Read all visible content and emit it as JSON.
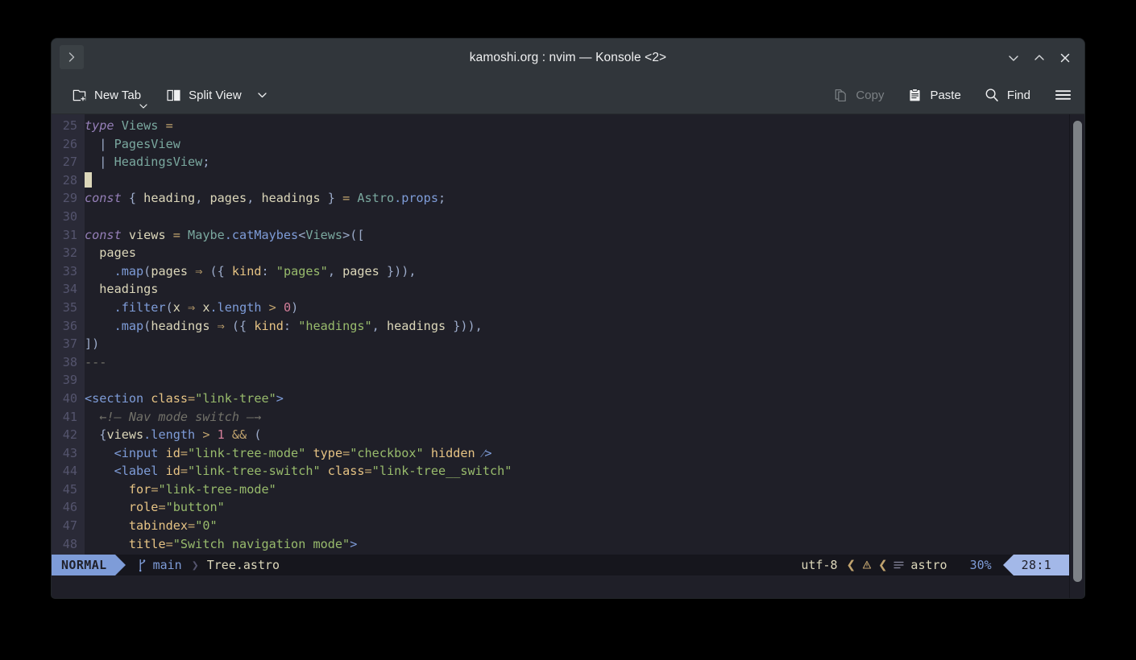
{
  "window": {
    "title": "kamoshi.org : nvim — Konsole <2>",
    "tab_scroll_icon": "chevron-right-icon",
    "controls": [
      {
        "name": "minimize",
        "glyph": "minimize-icon"
      },
      {
        "name": "maximize",
        "glyph": "maximize-icon"
      },
      {
        "name": "close",
        "glyph": "close-icon"
      }
    ]
  },
  "toolbar": {
    "new_tab_label": "New Tab",
    "split_view_label": "Split View",
    "copy_label": "Copy",
    "paste_label": "Paste",
    "find_label": "Find",
    "menu_label": "hamburger-menu-icon",
    "copy_disabled": true
  },
  "editor": {
    "first_line": 25,
    "lines": [
      {
        "n": "25",
        "tokens": [
          {
            "t": "type ",
            "c": "t-kw"
          },
          {
            "t": "Views ",
            "c": "t-type"
          },
          {
            "t": "=",
            "c": "t-op"
          }
        ]
      },
      {
        "n": "26",
        "tokens": [
          {
            "t": "  ",
            "c": "t-var"
          },
          {
            "t": "| ",
            "c": "t-punct"
          },
          {
            "t": "PagesView",
            "c": "t-type"
          }
        ]
      },
      {
        "n": "27",
        "tokens": [
          {
            "t": "  ",
            "c": "t-var"
          },
          {
            "t": "| ",
            "c": "t-punct"
          },
          {
            "t": "HeadingsView",
            "c": "t-type"
          },
          {
            "t": ";",
            "c": "t-punct"
          }
        ]
      },
      {
        "n": "28",
        "cursor": true,
        "tokens": []
      },
      {
        "n": "29",
        "tokens": [
          {
            "t": "const ",
            "c": "t-kw"
          },
          {
            "t": "{ ",
            "c": "t-punct"
          },
          {
            "t": "heading",
            "c": "t-var"
          },
          {
            "t": ", ",
            "c": "t-punct"
          },
          {
            "t": "pages",
            "c": "t-var"
          },
          {
            "t": ", ",
            "c": "t-punct"
          },
          {
            "t": "headings",
            "c": "t-var"
          },
          {
            "t": " } ",
            "c": "t-punct"
          },
          {
            "t": "= ",
            "c": "t-op"
          },
          {
            "t": "Astro",
            "c": "t-type"
          },
          {
            "t": ".props",
            "c": "t-fn"
          },
          {
            "t": ";",
            "c": "t-punct"
          }
        ]
      },
      {
        "n": "30",
        "tokens": []
      },
      {
        "n": "31",
        "tokens": [
          {
            "t": "const ",
            "c": "t-kw"
          },
          {
            "t": "views ",
            "c": "t-var"
          },
          {
            "t": "= ",
            "c": "t-op"
          },
          {
            "t": "Maybe",
            "c": "t-type"
          },
          {
            "t": ".catMaybes",
            "c": "t-fn"
          },
          {
            "t": "<",
            "c": "t-punct"
          },
          {
            "t": "Views",
            "c": "t-type"
          },
          {
            "t": ">([",
            "c": "t-punct"
          }
        ]
      },
      {
        "n": "32",
        "tokens": [
          {
            "t": "  pages",
            "c": "t-var"
          }
        ]
      },
      {
        "n": "33",
        "tokens": [
          {
            "t": "    ",
            "c": "t-var"
          },
          {
            "t": ".map",
            "c": "t-fn"
          },
          {
            "t": "(",
            "c": "t-punct"
          },
          {
            "t": "pages ",
            "c": "t-var"
          },
          {
            "t": "⇒",
            "c": "t-op"
          },
          {
            "t": " ({ ",
            "c": "t-punct"
          },
          {
            "t": "kind",
            "c": "t-prop"
          },
          {
            "t": ": ",
            "c": "t-punct"
          },
          {
            "t": "\"pages\"",
            "c": "t-str"
          },
          {
            "t": ", ",
            "c": "t-punct"
          },
          {
            "t": "pages",
            "c": "t-var"
          },
          {
            "t": " })),",
            "c": "t-punct"
          }
        ]
      },
      {
        "n": "34",
        "tokens": [
          {
            "t": "  headings",
            "c": "t-var"
          }
        ]
      },
      {
        "n": "35",
        "tokens": [
          {
            "t": "    ",
            "c": "t-var"
          },
          {
            "t": ".filter",
            "c": "t-fn"
          },
          {
            "t": "(",
            "c": "t-punct"
          },
          {
            "t": "x ",
            "c": "t-var"
          },
          {
            "t": "⇒",
            "c": "t-op"
          },
          {
            "t": " x",
            "c": "t-var"
          },
          {
            "t": ".length ",
            "c": "t-fn"
          },
          {
            "t": "> ",
            "c": "t-op"
          },
          {
            "t": "0",
            "c": "t-num"
          },
          {
            "t": ")",
            "c": "t-punct"
          }
        ]
      },
      {
        "n": "36",
        "tokens": [
          {
            "t": "    ",
            "c": "t-var"
          },
          {
            "t": ".map",
            "c": "t-fn"
          },
          {
            "t": "(",
            "c": "t-punct"
          },
          {
            "t": "headings ",
            "c": "t-var"
          },
          {
            "t": "⇒",
            "c": "t-op"
          },
          {
            "t": " ({ ",
            "c": "t-punct"
          },
          {
            "t": "kind",
            "c": "t-prop"
          },
          {
            "t": ": ",
            "c": "t-punct"
          },
          {
            "t": "\"headings\"",
            "c": "t-str"
          },
          {
            "t": ", ",
            "c": "t-punct"
          },
          {
            "t": "headings",
            "c": "t-var"
          },
          {
            "t": " })),",
            "c": "t-punct"
          }
        ]
      },
      {
        "n": "37",
        "tokens": [
          {
            "t": "])",
            "c": "t-punct"
          }
        ]
      },
      {
        "n": "38",
        "tokens": [
          {
            "t": "---",
            "c": "t-dim"
          }
        ]
      },
      {
        "n": "39",
        "tokens": []
      },
      {
        "n": "40",
        "tokens": [
          {
            "t": "<section ",
            "c": "t-tag"
          },
          {
            "t": "class",
            "c": "t-attr"
          },
          {
            "t": "=",
            "c": "t-op"
          },
          {
            "t": "\"link-tree\"",
            "c": "t-str"
          },
          {
            "t": ">",
            "c": "t-tag"
          }
        ]
      },
      {
        "n": "41",
        "tokens": [
          {
            "t": "  ←!— Nav mode switch —→",
            "c": "t-comment"
          }
        ]
      },
      {
        "n": "42",
        "tokens": [
          {
            "t": "  {",
            "c": "t-punct"
          },
          {
            "t": "views",
            "c": "t-var"
          },
          {
            "t": ".length ",
            "c": "t-fn"
          },
          {
            "t": "> ",
            "c": "t-op"
          },
          {
            "t": "1",
            "c": "t-num"
          },
          {
            "t": " && ",
            "c": "t-op"
          },
          {
            "t": "(",
            "c": "t-punct"
          }
        ]
      },
      {
        "n": "43",
        "tokens": [
          {
            "t": "    <input ",
            "c": "t-tag"
          },
          {
            "t": "id",
            "c": "t-attr"
          },
          {
            "t": "=",
            "c": "t-op"
          },
          {
            "t": "\"link-tree-mode\"",
            "c": "t-str"
          },
          {
            "t": " ",
            "c": "t-var"
          },
          {
            "t": "type",
            "c": "t-attr"
          },
          {
            "t": "=",
            "c": "t-op"
          },
          {
            "t": "\"checkbox\"",
            "c": "t-str"
          },
          {
            "t": " ",
            "c": "t-var"
          },
          {
            "t": "hidden",
            "c": "t-attr"
          },
          {
            "t": " ⁄>",
            "c": "t-tag"
          }
        ]
      },
      {
        "n": "44",
        "tokens": [
          {
            "t": "    <label ",
            "c": "t-tag"
          },
          {
            "t": "id",
            "c": "t-attr"
          },
          {
            "t": "=",
            "c": "t-op"
          },
          {
            "t": "\"link-tree-switch\"",
            "c": "t-str"
          },
          {
            "t": " ",
            "c": "t-var"
          },
          {
            "t": "class",
            "c": "t-attr"
          },
          {
            "t": "=",
            "c": "t-op"
          },
          {
            "t": "\"link-tree__switch\"",
            "c": "t-str"
          }
        ]
      },
      {
        "n": "45",
        "tokens": [
          {
            "t": "      ",
            "c": "t-var"
          },
          {
            "t": "for",
            "c": "t-attr"
          },
          {
            "t": "=",
            "c": "t-op"
          },
          {
            "t": "\"link-tree-mode\"",
            "c": "t-str"
          }
        ]
      },
      {
        "n": "46",
        "tokens": [
          {
            "t": "      ",
            "c": "t-var"
          },
          {
            "t": "role",
            "c": "t-attr"
          },
          {
            "t": "=",
            "c": "t-op"
          },
          {
            "t": "\"button\"",
            "c": "t-str"
          }
        ]
      },
      {
        "n": "47",
        "tokens": [
          {
            "t": "      ",
            "c": "t-var"
          },
          {
            "t": "tabindex",
            "c": "t-attr"
          },
          {
            "t": "=",
            "c": "t-op"
          },
          {
            "t": "\"0\"",
            "c": "t-str"
          }
        ]
      },
      {
        "n": "48",
        "tokens": [
          {
            "t": "      ",
            "c": "t-var"
          },
          {
            "t": "title",
            "c": "t-attr"
          },
          {
            "t": "=",
            "c": "t-op"
          },
          {
            "t": "\"Switch navigation mode\"",
            "c": "t-str"
          },
          {
            "t": ">",
            "c": "t-tag"
          }
        ]
      }
    ]
  },
  "statusline": {
    "mode": "NORMAL",
    "branch_icon": "git-branch-icon",
    "branch": "main",
    "filename": "Tree.astro",
    "encoding": "utf-8",
    "warn_icon": "warning-icon",
    "filetype_icon": "lines-icon",
    "filetype": "astro",
    "percent": "30%",
    "position": "28:1"
  },
  "colors": {
    "accent": "#7e9cd8",
    "mode_badge": "#7e9cd8",
    "position_badge": "#a3b8e8",
    "editor_bg": "#1f1f28",
    "gutter_bg": "#2a2a37",
    "statusline_bg": "#16161d",
    "chrome_bg": "#31363b",
    "cursor": "#dcd7ba"
  }
}
